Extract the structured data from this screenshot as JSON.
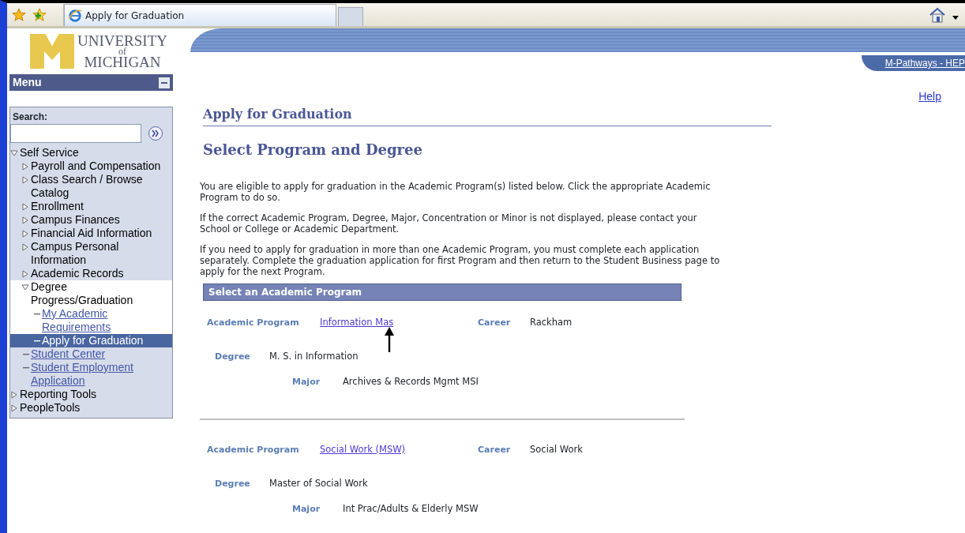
{
  "browser": {
    "tab_title": "Apply for Graduation"
  },
  "header": {
    "logo_lines": [
      "UNIVERSITY",
      "of",
      "MICHIGAN"
    ],
    "portal_link": "M-Pathways - HEP"
  },
  "menu": {
    "title": "Menu",
    "search_label": "Search:",
    "items": [
      {
        "label": "Self Service",
        "kind": "folder",
        "expanded": true,
        "children": [
          {
            "label": "Payroll and Compensation",
            "kind": "folder",
            "expanded": false
          },
          {
            "label": "Class Search / Browse Catalog",
            "kind": "folder",
            "expanded": false
          },
          {
            "label": "Enrollment",
            "kind": "folder",
            "expanded": false
          },
          {
            "label": "Campus Finances",
            "kind": "folder",
            "expanded": false
          },
          {
            "label": "Financial Aid Information",
            "kind": "folder",
            "expanded": false
          },
          {
            "label": "Campus Personal Information",
            "kind": "folder",
            "expanded": false
          },
          {
            "label": "Academic Records",
            "kind": "folder",
            "expanded": false
          },
          {
            "label": "Degree Progress/Graduation",
            "kind": "folder",
            "expanded": true,
            "children": [
              {
                "label": "My Academic Requirements",
                "kind": "link",
                "selected": false
              },
              {
                "label": "Apply for Graduation",
                "kind": "link",
                "selected": true
              }
            ]
          },
          {
            "label": "Student Center",
            "kind": "link",
            "selected": false
          },
          {
            "label": "Student Employment Application",
            "kind": "link",
            "selected": false
          }
        ]
      },
      {
        "label": "Reporting Tools",
        "kind": "folder",
        "expanded": false
      },
      {
        "label": "PeopleTools",
        "kind": "folder",
        "expanded": false
      }
    ]
  },
  "help_link": "Help",
  "page_title": "Apply for Graduation",
  "subtitle": "Select Program and Degree",
  "paragraphs": [
    "You are eligible to apply for graduation in the Academic Program(s) listed below. Click the appropriate Academic Program to do so.",
    "If the correct Academic Program, Degree, Major, Concentration or Minor is not displayed, please contact your School or College or Academic Department.",
    "If you need to apply for graduation in more than one Academic Program, you must complete each application separately. Complete the graduation application for first Program and then return to the Student Business page to apply for the next Program."
  ],
  "section_header": "Select an Academic Program",
  "programs": [
    {
      "program_label": "Academic Program",
      "program": "Information Mas",
      "career_label": "Career",
      "career": "Rackham",
      "degree_label": "Degree",
      "degree": "M. S. in Information",
      "major_label": "Major",
      "major": "Archives & Records Mgmt MSI",
      "pointer": true
    },
    {
      "program_label": "Academic Program",
      "program": "Social Work (MSW)",
      "career_label": "Career",
      "career": "Social Work",
      "degree_label": "Degree",
      "degree": "Master of Social Work",
      "major_label": "Major",
      "major": "Int Prac/Adults & Elderly MSW",
      "pointer": false
    }
  ]
}
